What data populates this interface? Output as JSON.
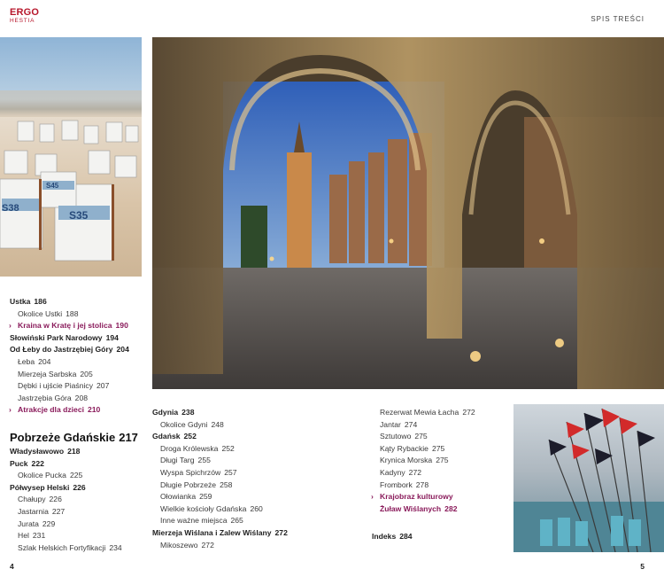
{
  "header": {
    "logo_top": "ERGO",
    "logo_bottom": "HESTIA",
    "section_label": "SPIS TREŚCI"
  },
  "col1": [
    {
      "label": "Ustka",
      "page": "186",
      "kind": "main"
    },
    {
      "label": "Okolice Ustki",
      "page": "188",
      "kind": "sub"
    },
    {
      "label": "Kraina w Kratę i jej stolica",
      "page": "190",
      "kind": "hl"
    },
    {
      "label": "Słowiński Park Narodowy",
      "page": "194",
      "kind": "main"
    },
    {
      "label": "Od Łeby do Jastrzębiej Góry",
      "page": "204",
      "kind": "main"
    },
    {
      "label": "Łeba",
      "page": "204",
      "kind": "sub"
    },
    {
      "label": "Mierzeja Sarbska",
      "page": "205",
      "kind": "sub"
    },
    {
      "label": "Dębki i ujście Piaśnicy",
      "page": "207",
      "kind": "sub"
    },
    {
      "label": "Jastrzębia Góra",
      "page": "208",
      "kind": "sub"
    },
    {
      "label": "Atrakcje dla dzieci",
      "page": "210",
      "kind": "hl"
    }
  ],
  "section": {
    "title": "Pobrzeże Gdańskie",
    "page": "217"
  },
  "col1b": [
    {
      "label": "Władysławowo",
      "page": "218",
      "kind": "main"
    },
    {
      "label": "Puck",
      "page": "222",
      "kind": "main"
    },
    {
      "label": "Okolice Pucka",
      "page": "225",
      "kind": "sub"
    },
    {
      "label": "Półwysep Helski",
      "page": "226",
      "kind": "main"
    },
    {
      "label": "Chałupy",
      "page": "226",
      "kind": "sub"
    },
    {
      "label": "Jastarnia",
      "page": "227",
      "kind": "sub"
    },
    {
      "label": "Jurata",
      "page": "229",
      "kind": "sub"
    },
    {
      "label": "Hel",
      "page": "231",
      "kind": "sub"
    },
    {
      "label": "Szlak Helskich Fortyfikacji",
      "page": "234",
      "kind": "sub"
    }
  ],
  "col2": [
    {
      "label": "Gdynia",
      "page": "238",
      "kind": "main"
    },
    {
      "label": "Okolice Gdyni",
      "page": "248",
      "kind": "sub"
    },
    {
      "label": "Gdańsk",
      "page": "252",
      "kind": "main"
    },
    {
      "label": "Droga Królewska",
      "page": "252",
      "kind": "sub"
    },
    {
      "label": "Długi Targ",
      "page": "255",
      "kind": "sub"
    },
    {
      "label": "Wyspa Spichrzów",
      "page": "257",
      "kind": "sub"
    },
    {
      "label": "Długie Pobrzeże",
      "page": "258",
      "kind": "sub"
    },
    {
      "label": "Ołowianka",
      "page": "259",
      "kind": "sub"
    },
    {
      "label": "Wielkie kościoły Gdańska",
      "page": "260",
      "kind": "sub"
    },
    {
      "label": "Inne ważne miejsca",
      "page": "265",
      "kind": "sub"
    },
    {
      "label": "Mierzeja Wiślana i Zalew Wiślany",
      "page": "272",
      "kind": "main"
    },
    {
      "label": "Mikoszewo",
      "page": "272",
      "kind": "sub"
    }
  ],
  "col3": [
    {
      "label": "Rezerwat Mewia Łacha",
      "page": "272",
      "kind": "sub"
    },
    {
      "label": "Jantar",
      "page": "274",
      "kind": "sub"
    },
    {
      "label": "Sztutowo",
      "page": "275",
      "kind": "sub"
    },
    {
      "label": "Kąty Rybackie",
      "page": "275",
      "kind": "sub"
    },
    {
      "label": "Krynica Morska",
      "page": "275",
      "kind": "sub"
    },
    {
      "label": "Kadyny",
      "page": "272",
      "kind": "sub"
    },
    {
      "label": "Frombork",
      "page": "278",
      "kind": "sub"
    },
    {
      "label": "Krajobraz kulturowy",
      "page": "",
      "kind": "hl"
    },
    {
      "label": "Żuław Wiślanych",
      "page": "282",
      "kind": "hl-cont"
    }
  ],
  "index": {
    "label": "Indeks",
    "page": "284"
  },
  "footer": {
    "left_page": "4",
    "right_page": "5"
  },
  "colors": {
    "brand": "#b7162b",
    "highlight": "#8a1b5b"
  }
}
